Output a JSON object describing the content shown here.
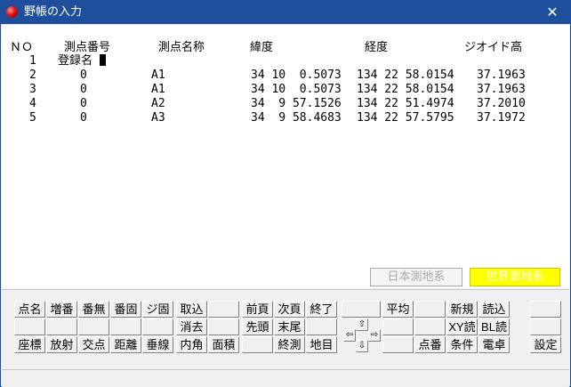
{
  "window": {
    "title": "野帳の入力",
    "close_glyph": "✕"
  },
  "table": {
    "headers": {
      "no": "ＮＯ",
      "point_number": "測点番号",
      "point_name": "測点名称",
      "latitude": "緯度",
      "longitude": "経度",
      "geoid": "ジオイド高"
    },
    "row1": {
      "no": "1",
      "label": "登録名"
    },
    "rows": [
      {
        "no": "2",
        "num": "0",
        "name": "A1",
        "lat": "34 10  0.5073",
        "lon": "134 22 58.0154",
        "geoid": "37.1963"
      },
      {
        "no": "3",
        "num": "0",
        "name": "A1",
        "lat": "34 10  0.5073",
        "lon": "134 22 58.0154",
        "geoid": "37.1963"
      },
      {
        "no": "4",
        "num": "0",
        "name": "A2",
        "lat": "34  9 57.1526",
        "lon": "134 22 51.4974",
        "geoid": "37.2010"
      },
      {
        "no": "5",
        "num": "0",
        "name": "A3",
        "lat": "34  9 58.4683",
        "lon": "134 22 57.5795",
        "geoid": "37.1972"
      }
    ]
  },
  "datum": {
    "japan": "日本測地系",
    "world": "世界測地系",
    "japan_color": "#a8a8a8",
    "world_color": "#ffff00"
  },
  "buttons": {
    "ten_mei": "点名",
    "zou_ban": "増番",
    "ban_mu": "番無",
    "ban_ko": "番固",
    "ji_ko": "ジ固",
    "tori_komi": "取込",
    "zen_page": "前頁",
    "ji_page": "次頁",
    "shuuryou": "終了",
    "heikin": "平均",
    "shinki": "新規",
    "yomi_komi": "読込",
    "shoukyo": "消去",
    "sentou": "先頭",
    "matsubi": "末尾",
    "xy_yomi": "XY読",
    "bl_yomi": "BL読",
    "zahyou": "座標",
    "housha": "放射",
    "kouten": "交点",
    "kyori": "距離",
    "suisen": "垂線",
    "naikaku": "内角",
    "menseki": "面積",
    "shuusoku": "終測",
    "chimoku": "地目",
    "tenban": "点番",
    "jouken": "条件",
    "dentaku": "電卓",
    "settei": "設定"
  },
  "arrows": {
    "up": "⇧",
    "down": "⇩",
    "left": "⇦",
    "right": "⇨"
  }
}
